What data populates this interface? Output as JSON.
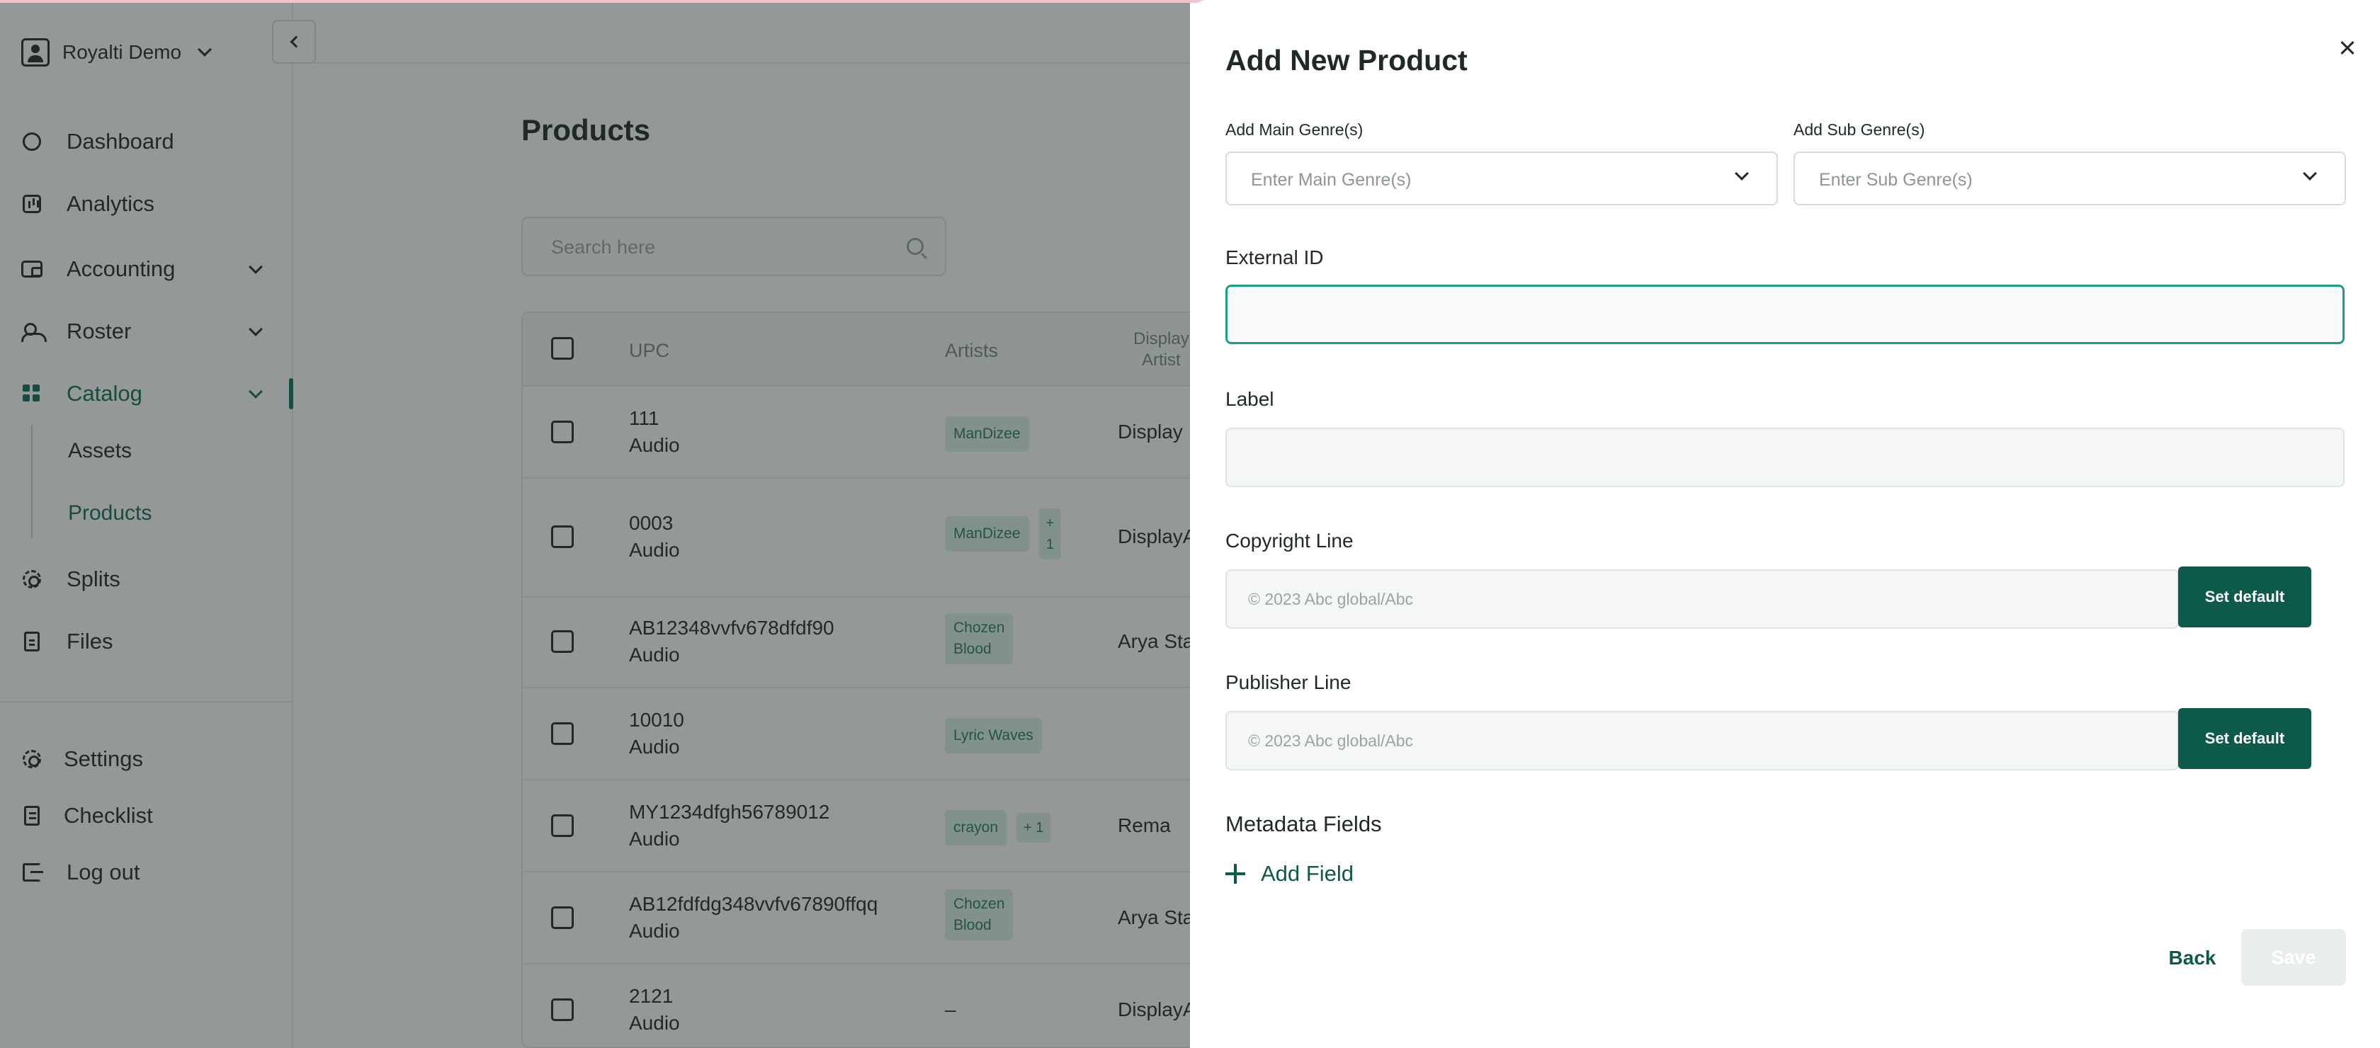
{
  "workspace": {
    "name": "Royalti Demo"
  },
  "sidebar": {
    "items": [
      {
        "label": "Dashboard"
      },
      {
        "label": "Analytics"
      },
      {
        "label": "Accounting"
      },
      {
        "label": "Roster"
      },
      {
        "label": "Catalog",
        "active": true
      },
      {
        "label": "Splits"
      },
      {
        "label": "Files"
      }
    ],
    "catalog_sub": [
      {
        "label": "Assets"
      },
      {
        "label": "Products",
        "active": true
      }
    ],
    "bottom": [
      {
        "label": "Settings"
      },
      {
        "label": "Checklist"
      },
      {
        "label": "Log out"
      }
    ]
  },
  "page": {
    "title": "Products",
    "search_placeholder": "Search here"
  },
  "table": {
    "headers": {
      "upc": "UPC",
      "artists": "Artists",
      "display_artist_1": "Display",
      "display_artist_2": "Artist"
    },
    "rows": [
      {
        "upc": "111",
        "type": "Audio",
        "artists": [
          "ManDizee"
        ],
        "more": "",
        "display": "Display"
      },
      {
        "upc": "0003",
        "type": "Audio",
        "artists": [
          "ManDizee"
        ],
        "more": "+\n1",
        "display": "DisplayA"
      },
      {
        "upc": "AB12348vvfv678dfdf90",
        "type": "Audio",
        "artists": [
          "Chozen\nBlood"
        ],
        "more": "",
        "display": "Arya Star"
      },
      {
        "upc": "10010",
        "type": "Audio",
        "artists": [
          "Lyric Waves"
        ],
        "more": "",
        "display": ""
      },
      {
        "upc": "MY1234dfgh56789012",
        "type": "Audio",
        "artists": [
          "crayon"
        ],
        "more": "+ 1",
        "display": "Rema"
      },
      {
        "upc": "AB12fdfdg348vvfv67890ffqq",
        "type": "Audio",
        "artists": [
          "Chozen\nBlood"
        ],
        "more": "",
        "display": "Arya Star"
      },
      {
        "upc": "2121",
        "type": "Audio",
        "artists": [
          "–"
        ],
        "more": "",
        "display": "DisplayA"
      }
    ]
  },
  "drawer": {
    "title": "Add New Product",
    "main_genre": {
      "label": "Add Main Genre(s)",
      "placeholder": "Enter Main Genre(s)"
    },
    "sub_genre": {
      "label": "Add Sub Genre(s)",
      "placeholder": "Enter Sub Genre(s)"
    },
    "external_id": {
      "label": "External ID",
      "value": ""
    },
    "label_field": {
      "label": "Label",
      "value": ""
    },
    "copyright": {
      "label": "Copyright Line",
      "placeholder": "© 2023 Abc global/Abc",
      "button": "Set default"
    },
    "publisher": {
      "label": "Publisher Line",
      "placeholder": "© 2023 Abc global/Abc",
      "button": "Set default"
    },
    "metadata_title": "Metadata Fields",
    "add_field_label": "Add Field",
    "back_label": "Back",
    "save_label": "Save"
  },
  "colors": {
    "brand": "#0d5a4b",
    "accent": "#0f6b5c",
    "focus": "#1f9e87",
    "tag_bg": "#dcefe5"
  },
  "icons": {
    "dashboard": "pie-chart-icon",
    "analytics": "bar-chart-icon",
    "accounting": "wallet-icon",
    "roster": "people-icon",
    "catalog": "grid-icon",
    "splits": "splits-icon",
    "files": "file-icon",
    "settings": "gear-icon",
    "checklist": "checklist-icon",
    "logout": "logout-icon",
    "search": "search-icon",
    "close": "close-icon",
    "add": "plus-icon"
  }
}
